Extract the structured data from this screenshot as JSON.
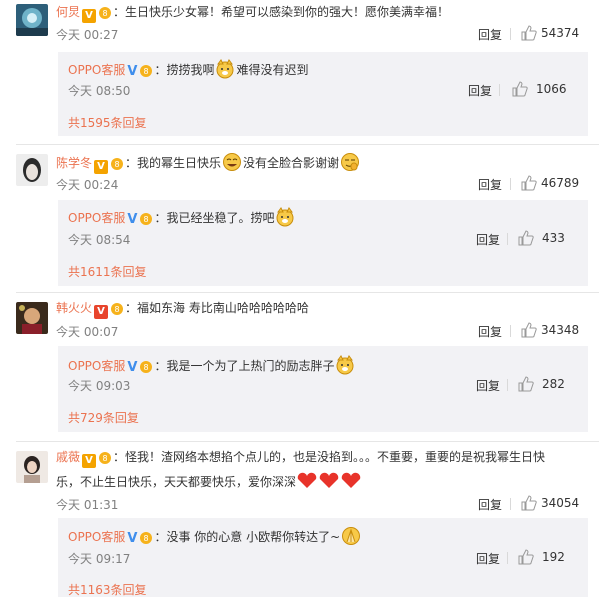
{
  "comments": [
    {
      "user": "何炅",
      "text": "生日快乐少女幂！希望可以感染到你的强大！愿你美满幸福！",
      "time": "今天 00:27",
      "reply_label": "回复",
      "likes": "54374",
      "reply": {
        "user": "OPPO客服",
        "text_a": "捞捞我啊",
        "text_b": "难得没有迟到",
        "time": "今天 08:50",
        "reply_label": "回复",
        "likes": "1066"
      },
      "more": "共1595条回复"
    },
    {
      "user": "陈学冬",
      "text_a": "我的幂生日快乐",
      "text_b": "没有全脸合影谢谢",
      "time": "今天 00:24",
      "reply_label": "回复",
      "likes": "46789",
      "reply": {
        "user": "OPPO客服",
        "text_a": "我已经坐稳了。捞吧",
        "time": "今天 08:54",
        "reply_label": "回复",
        "likes": "433"
      },
      "more": "共1611条回复"
    },
    {
      "user": "韩火火",
      "text": "福如东海 寿比南山哈哈哈哈哈哈",
      "time": "今天 00:07",
      "reply_label": "回复",
      "likes": "34348",
      "reply": {
        "user": "OPPO客服",
        "text_a": "我是一个为了上热门的励志胖子",
        "time": "今天 09:03",
        "reply_label": "回复",
        "likes": "282"
      },
      "more": "共729条回复"
    },
    {
      "user": "戚薇",
      "text_line1": "怪我！渣网络本想掐个点儿的，也是没掐到。。。不重要，重要的是祝我幂生日快",
      "text_line2": "乐，不止生日快乐，天天都要快乐，爱你深深",
      "time": "今天 01:31",
      "reply_label": "回复",
      "likes": "34054",
      "reply": {
        "user": "OPPO客服",
        "text_a": "没事 你的心意 小欧帮你转达了~",
        "time": "今天 09:17",
        "reply_label": "回复",
        "likes": "192"
      },
      "more": "共1163条回复"
    }
  ],
  "colors": {
    "username": "#eb7350",
    "vip": "#3f8eec",
    "reply_bg": "#f2f2f5"
  }
}
